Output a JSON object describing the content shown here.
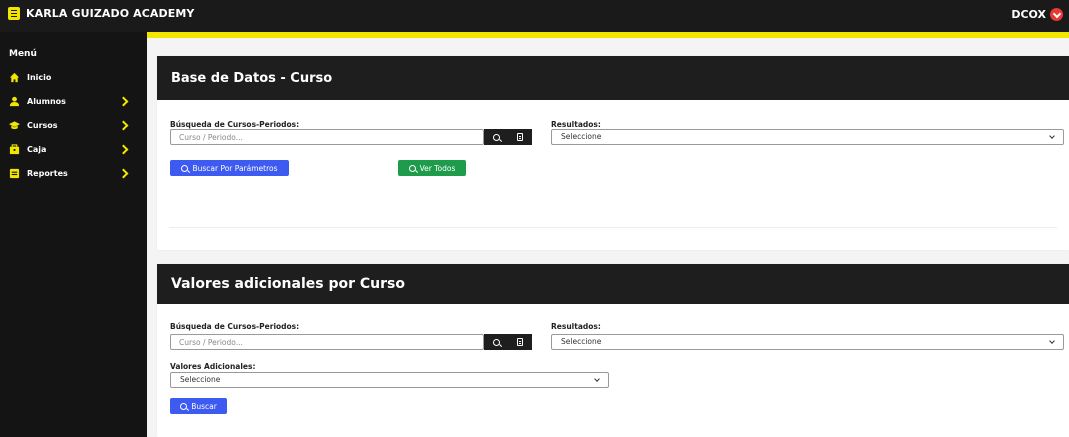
{
  "topbar": {
    "brand": "KARLA GUIZADO ACADEMY",
    "user": "DCOX"
  },
  "colors": {
    "accent": "#f2e600",
    "dark": "#1e1e1e",
    "primary": "#3d5af1",
    "success": "#1e9c4c"
  },
  "sidebar": {
    "title": "Menú",
    "items": [
      {
        "label": "Inicio",
        "icon": "home-icon",
        "has_submenu": false
      },
      {
        "label": "Alumnos",
        "icon": "user-icon",
        "has_submenu": true
      },
      {
        "label": "Cursos",
        "icon": "graduation-icon",
        "has_submenu": true
      },
      {
        "label": "Caja",
        "icon": "cash-box-icon",
        "has_submenu": true
      },
      {
        "label": "Reportes",
        "icon": "report-icon",
        "has_submenu": true
      }
    ]
  },
  "card1": {
    "title": "Base de Datos - Curso",
    "search_label": "Búsqueda de Cursos-Periodos:",
    "search_placeholder": "Curso / Periodo...",
    "results_label": "Resultados:",
    "results_selected": "Seleccione",
    "btn_params": "Buscar Por Parámetros",
    "btn_all": "Ver Todos"
  },
  "card2": {
    "title": "Valores adicionales por Curso",
    "search_label": "Búsqueda de Cursos-Periodos:",
    "search_placeholder": "Curso / Periodo...",
    "results_label": "Resultados:",
    "results_selected": "Seleccione",
    "extra_label": "Valores Adicionales:",
    "extra_selected": "Seleccione",
    "btn_search": "Buscar"
  }
}
